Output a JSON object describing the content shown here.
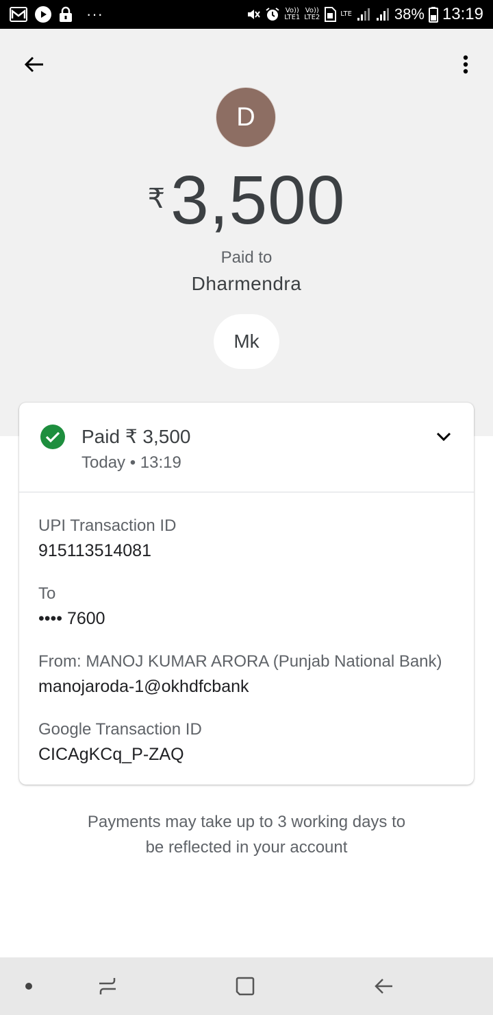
{
  "status_bar": {
    "volte1": "Vo))",
    "lte1": "LTE1",
    "volte2": "Vo))",
    "lte2": "LTE2",
    "network": "LTE",
    "battery": "38%",
    "time": "13:19",
    "dots": "···"
  },
  "payment": {
    "avatar_initial": "D",
    "currency_symbol": "₹",
    "amount": "3,500",
    "paid_to_label": "Paid to",
    "payee": "Dharmendra",
    "note": "Mk"
  },
  "card": {
    "status_title": "Paid ₹ 3,500",
    "status_time": "Today • 13:19",
    "details": [
      {
        "label": "UPI Transaction ID",
        "value": "915113514081"
      },
      {
        "label": "To",
        "value": "•••• 7600"
      },
      {
        "label": "From: MANOJ KUMAR ARORA (Punjab National Bank)",
        "value": "manojaroda-1@okhdfcbank"
      },
      {
        "label": "Google Transaction ID",
        "value": "CICAgKCq_P-ZAQ"
      }
    ]
  },
  "footer": {
    "line1": "Payments may take up to 3 working days to",
    "line2": "be reflected in your account"
  },
  "colors": {
    "avatar": "#8d6e63",
    "success": "#1e8e3e",
    "top_background": "#f1f1f1"
  }
}
